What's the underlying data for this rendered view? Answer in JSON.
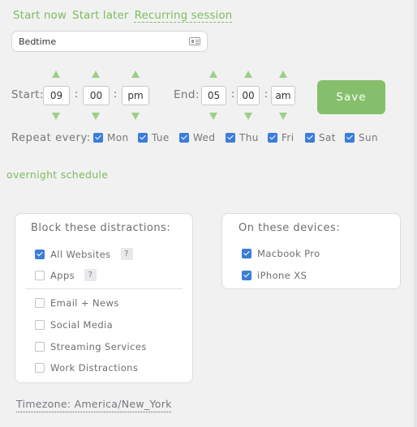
{
  "tabs": [
    "Start now",
    "Start later",
    "Recurring session"
  ],
  "session": {
    "name": "Bedtime"
  },
  "time": {
    "start_label": "Start:",
    "end_label": "End:",
    "start": {
      "hour": "09",
      "minute": "00",
      "period": "pm"
    },
    "end": {
      "hour": "05",
      "minute": "00",
      "period": "am"
    },
    "separator": ":"
  },
  "save_label": "Save",
  "repeat": {
    "label": "Repeat every:",
    "days": [
      {
        "label": "Mon",
        "checked": true
      },
      {
        "label": "Tue",
        "checked": true
      },
      {
        "label": "Wed",
        "checked": true
      },
      {
        "label": "Thu",
        "checked": true
      },
      {
        "label": "Fri",
        "checked": true
      },
      {
        "label": "Sat",
        "checked": true
      },
      {
        "label": "Sun",
        "checked": true
      }
    ]
  },
  "overnight_label": "overnight schedule",
  "block": {
    "title": "Block these distractions:",
    "help": "?",
    "items": [
      {
        "label": "All Websites",
        "checked": true
      },
      {
        "label": "Apps",
        "checked": false
      },
      {
        "label": "Email + News",
        "checked": false
      },
      {
        "label": "Social Media",
        "checked": false
      },
      {
        "label": "Streaming Services",
        "checked": false
      },
      {
        "label": "Work Distractions",
        "checked": false
      }
    ]
  },
  "devices": {
    "title": "On these devices:",
    "items": [
      {
        "label": "Macbook Pro",
        "checked": true
      },
      {
        "label": "iPhone XS",
        "checked": true
      }
    ]
  },
  "timezone": "Timezone: America/New_York",
  "colors": {
    "accent": "#7cbd5c",
    "save_button": "#85bf6b",
    "arrow": "#9bd087",
    "checkbox": "#3b7dd8"
  }
}
